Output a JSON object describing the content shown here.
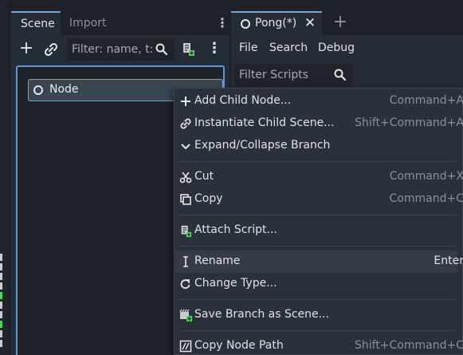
{
  "scene_dock": {
    "tabs": [
      {
        "label": "Scene",
        "active": true
      },
      {
        "label": "Import",
        "active": false
      }
    ],
    "filter_placeholder": "Filter: name, t:t",
    "tree": {
      "root_node": "Node"
    }
  },
  "script_editor": {
    "tab": {
      "label": "Pong(*)"
    },
    "menus": [
      "File",
      "Search",
      "Debug"
    ],
    "filter_placeholder": "Filter Scripts"
  },
  "context_menu": {
    "items": [
      {
        "label": "Add Child Node...",
        "shortcut": "Command+A",
        "icon": "add-icon"
      },
      {
        "label": "Instantiate Child Scene...",
        "shortcut": "Shift+Command+A",
        "icon": "link-icon"
      },
      {
        "label": "Expand/Collapse Branch",
        "shortcut": "",
        "icon": "chevron-down-icon"
      },
      {
        "label": "Cut",
        "shortcut": "Command+X",
        "icon": "scissors-icon"
      },
      {
        "label": "Copy",
        "shortcut": "Command+C",
        "icon": "copy-icon"
      },
      {
        "label": "Attach Script...",
        "shortcut": "",
        "icon": "attach-script-icon"
      },
      {
        "label": "Rename",
        "shortcut": "Enter",
        "icon": "rename-icon",
        "highlighted": true
      },
      {
        "label": "Change Type...",
        "shortcut": "",
        "icon": "change-type-icon"
      },
      {
        "label": "Save Branch as Scene...",
        "shortcut": "",
        "icon": "save-branch-icon"
      },
      {
        "label": "Copy Node Path",
        "shortcut": "Shift+Command+C",
        "icon": "copy-path-icon"
      }
    ]
  },
  "colors": {
    "accent": "#6ba7e6",
    "selection_border": "#5b9bd5",
    "panel": "#262c35",
    "menu": "#2b313a",
    "hover": "#353c47"
  }
}
